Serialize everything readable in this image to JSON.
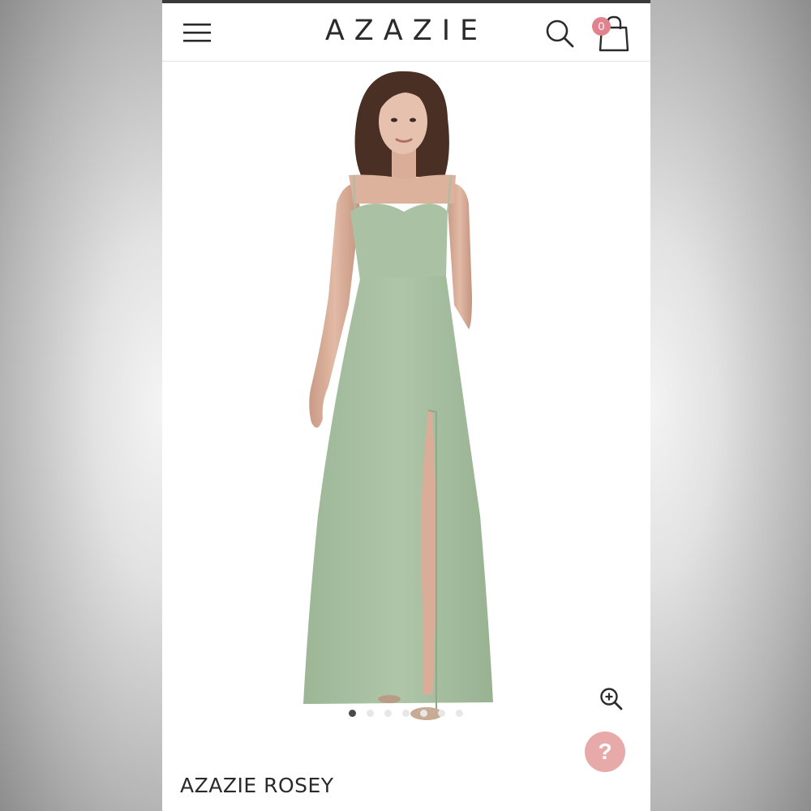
{
  "header": {
    "logo_text": "AZAZIE",
    "menu_icon": "hamburger-menu-icon",
    "search_icon": "search-icon",
    "cart_icon": "shopping-bag-icon",
    "cart_count": "0"
  },
  "product": {
    "name": "AZAZIE ROSEY",
    "dress_color": "#a9c2a2",
    "image_index": 1,
    "image_count": 7
  },
  "actions": {
    "zoom_icon": "zoom-in-icon",
    "help_label": "?"
  },
  "colors": {
    "accent": "#e0838f",
    "help_button": "#e8a9a9",
    "text": "#2a2a2a"
  }
}
